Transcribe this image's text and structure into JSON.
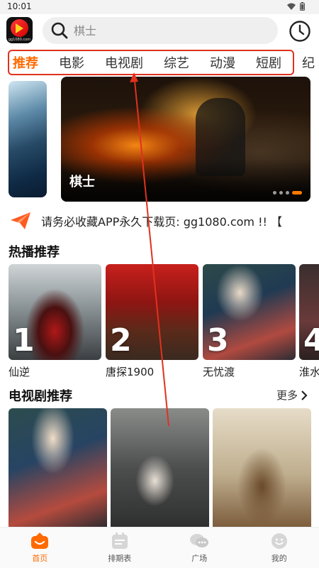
{
  "status_bar": {
    "time": "10:01"
  },
  "logo": {
    "text": "gg1080.com"
  },
  "search": {
    "placeholder": "棋士"
  },
  "tabs": [
    {
      "label": "推荐"
    },
    {
      "label": "电影"
    },
    {
      "label": "电视剧"
    },
    {
      "label": "综艺"
    },
    {
      "label": "动漫"
    },
    {
      "label": "短剧"
    },
    {
      "label": "纪"
    }
  ],
  "banner": {
    "title": "棋士"
  },
  "notice": {
    "text": "请务必收藏APP永久下载页: gg1080.com !! 【"
  },
  "hot_section": {
    "title": "热播推荐",
    "items": [
      {
        "rank": "1",
        "name": "仙逆"
      },
      {
        "rank": "2",
        "name": "唐探1900"
      },
      {
        "rank": "3",
        "name": "无忧渡"
      },
      {
        "rank": "4",
        "name": "淮水"
      }
    ]
  },
  "tv_section": {
    "title": "电视剧推荐",
    "more": "更多"
  },
  "bottom_nav": [
    {
      "label": "首页"
    },
    {
      "label": "排期表"
    },
    {
      "label": "广场"
    },
    {
      "label": "我的"
    }
  ],
  "colors": {
    "accent": "#ff6a00",
    "highlight": "#e0321e"
  }
}
